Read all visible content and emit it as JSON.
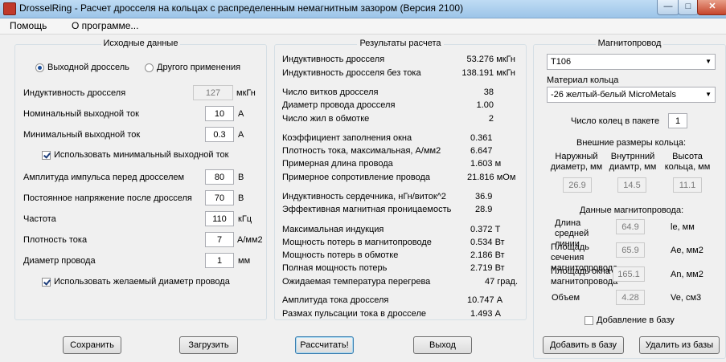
{
  "window": {
    "title": "DrosselRing - Расчет дросселя на кольцах с распределенным немагнитным зазором (Версия 2100)"
  },
  "menu": [
    "Помощь",
    "О программе..."
  ],
  "input": {
    "title": "Исходные данные",
    "radio_output": "Выходной дроссель",
    "radio_other": "Другого применения",
    "inductance": {
      "label": "Индуктивность  дросселя",
      "value": "127",
      "unit": "мкГн"
    },
    "nominal_current": {
      "label": "Номинальный выходной ток",
      "value": "10",
      "unit": "А"
    },
    "min_current": {
      "label": "Минимальный выходной ток",
      "value": "0.3",
      "unit": "А"
    },
    "use_min_current": "Использовать минимальный выходной ток",
    "pulse_amplitude": {
      "label": "Амплитуда импульса перед дросселем",
      "value": "80",
      "unit": "В"
    },
    "dc_voltage": {
      "label": "Постоянное напряжение после дросселя",
      "value": "70",
      "unit": "В"
    },
    "frequency": {
      "label": "Частота",
      "value": "110",
      "unit": "кГц"
    },
    "current_density": {
      "label": "Плотность тока",
      "value": "7",
      "unit": "А/мм2"
    },
    "wire_diameter": {
      "label": "Диаметр провода",
      "value": "1",
      "unit": "мм"
    },
    "use_wire_diameter": "Использовать желаемый диаметр провода"
  },
  "results": {
    "title": "Результаты расчета",
    "rows": [
      {
        "label": "Индуктивность дросселя",
        "value": "53.276 мкГн"
      },
      {
        "label": "Индуктивность дросселя без тока",
        "value": "138.191 мкГн"
      },
      {
        "label": "Число витков дросселя",
        "value": "38"
      },
      {
        "label": "Диаметр провода дросселя",
        "value": "1.00"
      },
      {
        "label": "Число жил в обмотке",
        "value": "2"
      },
      {
        "label": "Коэффициент заполнения окна",
        "value": "0.361"
      },
      {
        "label": "Плотность тока, максимальная, А/мм2",
        "value": "6.647"
      },
      {
        "label": "Примерная длина провода",
        "value": "1.603 м"
      },
      {
        "label": "Примерное сопротивление провода",
        "value": "21.816 мОм"
      },
      {
        "label": "Индуктивность сердечника, нГн/виток^2",
        "value": "36.9"
      },
      {
        "label": "Эффективная магнитная проницаемость",
        "value": "28.9"
      },
      {
        "label": "Максимальная индукция",
        "value": "0.372 Т"
      },
      {
        "label": "Мощность потерь в магнитопроводе",
        "value": "0.534 Вт"
      },
      {
        "label": "Мощность потерь в обмотке",
        "value": "2.186 Вт"
      },
      {
        "label": "Полная мощность потерь",
        "value": "2.719 Вт"
      },
      {
        "label": "Ожидаемая температура перегрева",
        "value": "47 град."
      },
      {
        "label": "Амплитуда тока дросселя",
        "value": "10.747 А"
      },
      {
        "label": "Размах пульсации тока в дросселе",
        "value": "1.493 А"
      }
    ]
  },
  "core": {
    "title": "Магнитопровод",
    "core_select": "T106",
    "material_label": "Материал кольца",
    "material_select": "-26 желтый-белый MicroMetals",
    "rings_label": "Число колец в пакете",
    "rings_value": "1",
    "ext_dims_label": "Внешние размеры кольца:",
    "outer_label": "Наружный диаметр, мм",
    "inner_label": "Внутрнний диамтр, мм",
    "height_label": "Высота кольца, мм",
    "outer_value": "26.9",
    "inner_value": "14.5",
    "height_value": "11.1",
    "mag_data_label": "Данные магнитопровода:",
    "le_label": "Длина средней линии",
    "le_value": "64.9",
    "le_unit": "le, мм",
    "ae_label": "Площадь сечения магнитопровода",
    "ae_value": "65.9",
    "ae_unit": "Ae, мм2",
    "an_label": "Площадь окна магнитопровода",
    "an_value": "165.1",
    "an_unit": "An, мм2",
    "ve_label": "Объем",
    "ve_value": "4.28",
    "ve_unit": "Ve, см3",
    "add_to_db_check": "Добавление в базу"
  },
  "buttons": {
    "save": "Сохранить",
    "load": "Загрузить",
    "calculate": "Рассчитать!",
    "exit": "Выход",
    "add_db": "Добавить в базу",
    "remove_db": "Удалить из базы"
  }
}
